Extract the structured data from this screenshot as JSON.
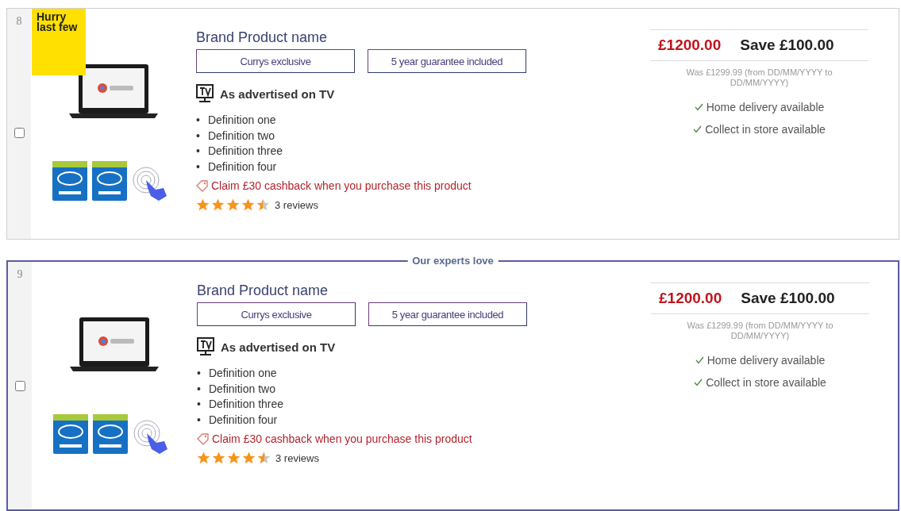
{
  "products": [
    {
      "index": "8",
      "selected": false,
      "flag": "Hurry last few",
      "bullet": "•",
      "name": "Brand Product name",
      "badges": [
        "Currys exclusive",
        "5 year guarantee included"
      ],
      "promo": "As advertised on TV",
      "features": [
        "Definition one",
        "Definition two",
        "Definition three",
        "Definition four"
      ],
      "offer": "Claim £30 cashback when you purchase this product",
      "stars": 4.5,
      "reviews": "3 reviews",
      "price": "£1200.00",
      "saving": "Save £100.00",
      "was": "Was £1299.99 (from DD/MM/YYYY to DD/MM/YYYY)",
      "availability": [
        "Home delivery available",
        "Collect in store available"
      ]
    },
    {
      "index": "9",
      "selected": false,
      "highlight": "Our experts love",
      "bullet": "•",
      "name": "Brand Product name",
      "badges": [
        "Currys exclusive",
        "5 year guarantee included"
      ],
      "promo": "As advertised on TV",
      "features": [
        "Definition one",
        "Definition two",
        "Definition three",
        "Definition four"
      ],
      "offer": "Claim £30 cashback when you purchase this product",
      "stars": 4.5,
      "reviews": "3 reviews",
      "price": "£1200.00",
      "saving": "Save £100.00",
      "was": "Was £1299.99 (from DD/MM/YYYY to DD/MM/YYYY)",
      "availability": [
        "Home delivery available",
        "Collect in store available"
      ]
    }
  ]
}
